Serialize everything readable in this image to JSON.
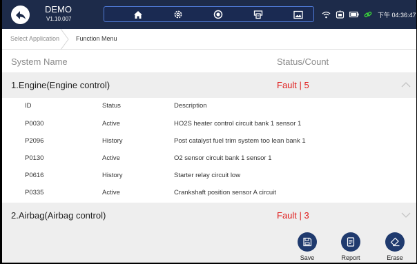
{
  "header": {
    "app_name": "DEMO",
    "version": "V1.10.007",
    "nav_icons": [
      "home-icon",
      "settings-icon",
      "record-icon",
      "print-icon",
      "screenshot-icon"
    ],
    "status_icons": [
      "wifi-icon",
      "vci-icon",
      "battery-icon",
      "link-icon"
    ],
    "time": "下午 04:36:47"
  },
  "breadcrumb": {
    "items": [
      "Select Application",
      "Function Menu"
    ]
  },
  "columns": {
    "system": "System Name",
    "status": "Status/Count"
  },
  "systems": [
    {
      "name": "1.Engine(Engine control)",
      "status": "Fault | 5",
      "expanded": true,
      "fault_headers": {
        "id": "ID",
        "status": "Status",
        "description": "Description"
      },
      "faults": [
        {
          "id": "P0030",
          "status": "Active",
          "description": "HO2S heater control circuit bank 1  sensor 1"
        },
        {
          "id": "P2096",
          "status": "History",
          "description": "Post catalyst fuel trim system too lean bank 1"
        },
        {
          "id": "P0130",
          "status": "Active",
          "description": "O2 sensor circuit bank 1 sensor 1"
        },
        {
          "id": "P0616",
          "status": "History",
          "description": "Starter relay circuit low"
        },
        {
          "id": "P0335",
          "status": "Active",
          "description": "Crankshaft position sensor A circuit"
        }
      ]
    },
    {
      "name": "2.Airbag(Airbag control)",
      "status": "Fault | 3",
      "expanded": false
    }
  ],
  "actions": {
    "save": "Save",
    "report": "Report",
    "erase": "Erase"
  },
  "colors": {
    "header_bg": "#1d2b4a",
    "fault_red": "#e01b1b",
    "button_blue": "#1f3a6e",
    "wifi_green": "#3bd13b"
  }
}
